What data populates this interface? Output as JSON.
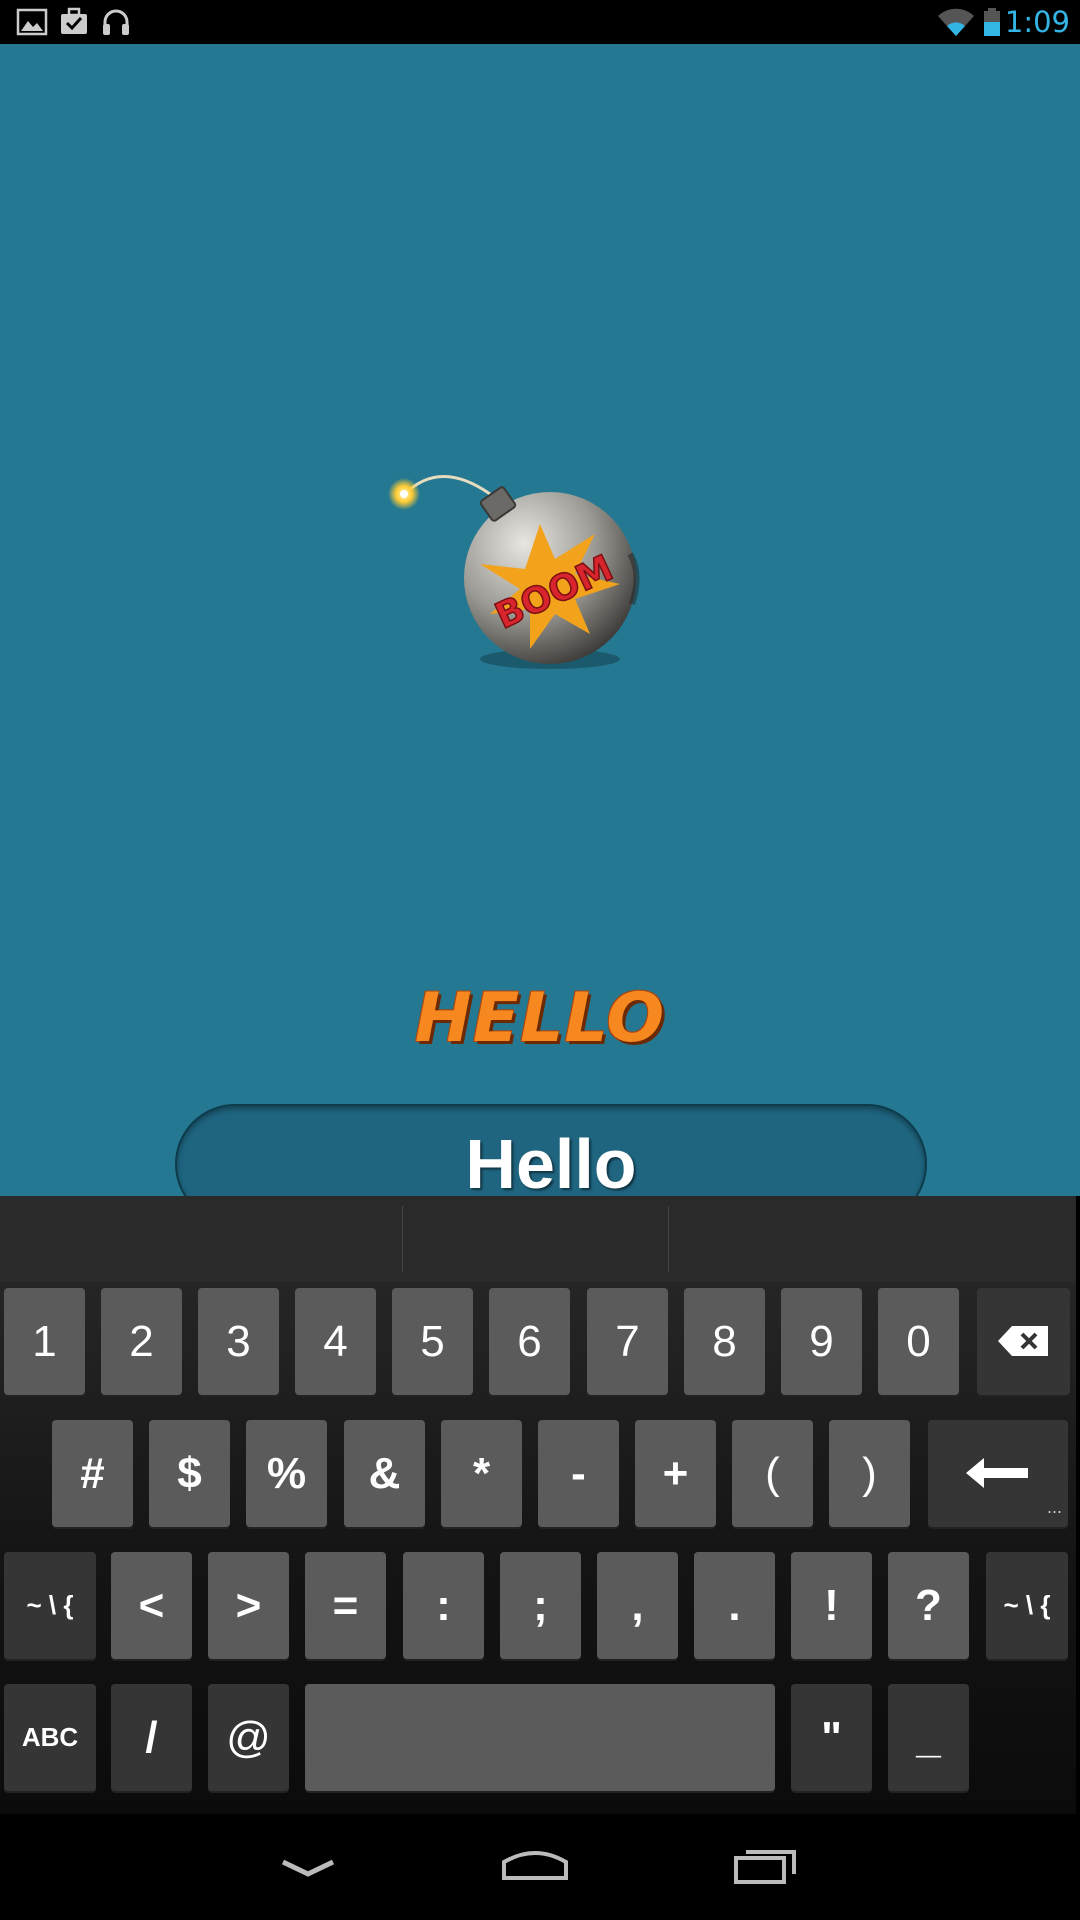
{
  "status_bar": {
    "time": "1:09",
    "icons": [
      "picture-icon",
      "briefcase-check-icon",
      "headphones-icon",
      "wifi-icon",
      "battery-icon"
    ]
  },
  "app": {
    "title": "HELLO",
    "input_value": "Hello",
    "background_color": "#247891",
    "title_color": "#f7881f",
    "bomb_label": "BOOM"
  },
  "keyboard": {
    "row1": [
      "1",
      "2",
      "3",
      "4",
      "5",
      "6",
      "7",
      "8",
      "9",
      "0"
    ],
    "row2": [
      "#",
      "$",
      "%",
      "&",
      "*",
      "-",
      "+",
      "(",
      ")"
    ],
    "row3_left": "~ \\ {",
    "row3": [
      "<",
      ">",
      "=",
      ":",
      ";",
      ",",
      ".",
      "!",
      "?"
    ],
    "row3_right": "~ \\ {",
    "abc_label": "ABC",
    "row4": [
      "/",
      "@"
    ],
    "row4_right": [
      "\"",
      "_"
    ],
    "more_dots": "..."
  },
  "nav_bar": {
    "icons": [
      "back-icon",
      "home-icon",
      "recent-apps-icon"
    ]
  }
}
